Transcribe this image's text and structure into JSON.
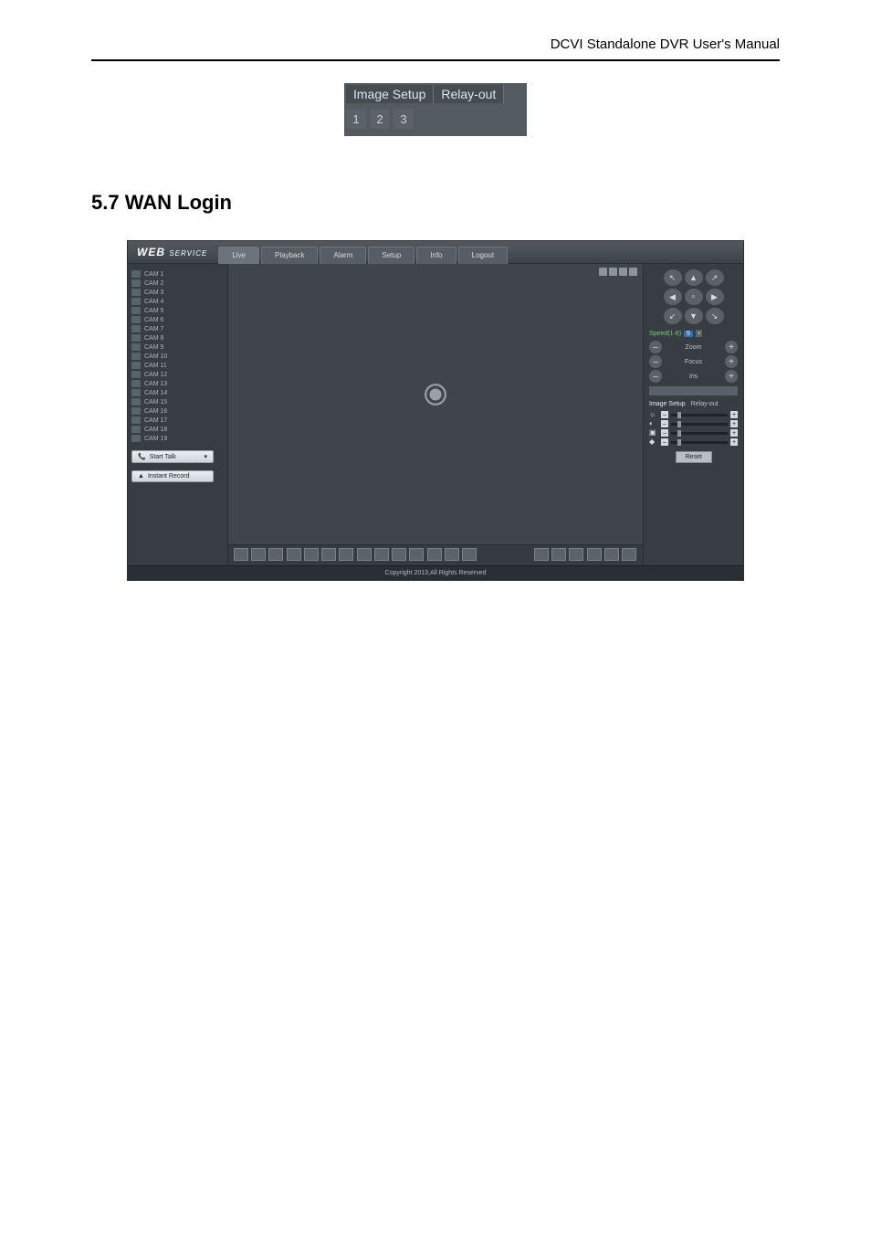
{
  "header": {
    "right": "DCVI Standalone DVR User's Manual"
  },
  "mini": {
    "tabs": [
      "Image Setup",
      "Relay-out"
    ],
    "numbers": [
      "1",
      "2",
      "3"
    ]
  },
  "section": {
    "title": "5.7  WAN Login"
  },
  "webui": {
    "logo_main": "WEB",
    "logo_sub": "SERVICE",
    "nav": [
      "Live",
      "Playback",
      "Alarm",
      "Setup",
      "Info",
      "Logout"
    ],
    "cameras": [
      "CAM 1",
      "CAM 2",
      "CAM 3",
      "CAM 4",
      "CAM 5",
      "CAM 6",
      "CAM 7",
      "CAM 8",
      "CAM 9",
      "CAM 10",
      "CAM 11",
      "CAM 12",
      "CAM 13",
      "CAM 14",
      "CAM 15",
      "CAM 16",
      "CAM 17",
      "CAM 18",
      "CAM 19"
    ],
    "start_talk": "Start Talk",
    "instant_record": "Instant Record",
    "speed_label": "Speed(1-8)",
    "speed_val": "5",
    "zoom": "Zoom",
    "focus": "Focus",
    "iris": "Iris",
    "right_tabs": [
      "Image Setup",
      "Relay-out"
    ],
    "reset": "Reset",
    "copyright": "Copyright 2013,All Rights Reserved"
  }
}
